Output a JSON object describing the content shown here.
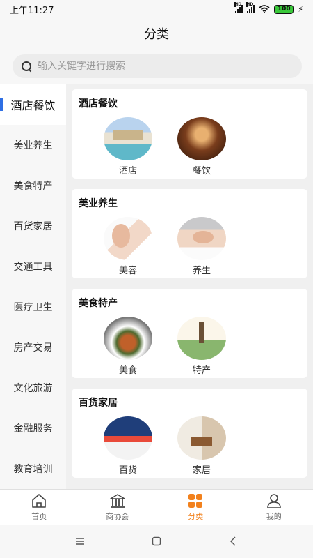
{
  "status": {
    "time": "上午11:27",
    "battery": "100",
    "hd1": "HD",
    "hd2": "HD"
  },
  "header": {
    "title": "分类"
  },
  "search": {
    "placeholder": "输入关键字进行搜索"
  },
  "sidebar": {
    "items": [
      {
        "label": "酒店餐饮",
        "active": true
      },
      {
        "label": "美业养生"
      },
      {
        "label": "美食特产"
      },
      {
        "label": "百货家居"
      },
      {
        "label": "交通工具"
      },
      {
        "label": "医疗卫生"
      },
      {
        "label": "房产交易"
      },
      {
        "label": "文化旅游"
      },
      {
        "label": "金融服务"
      },
      {
        "label": "教育培训"
      }
    ]
  },
  "sections": [
    {
      "title": "酒店餐饮",
      "items": [
        {
          "label": "酒店",
          "icon": "hotel-image"
        },
        {
          "label": "餐饮",
          "icon": "dining-image"
        }
      ]
    },
    {
      "title": "美业养生",
      "items": [
        {
          "label": "美容",
          "icon": "beauty-image"
        },
        {
          "label": "养生",
          "icon": "wellness-image"
        }
      ]
    },
    {
      "title": "美食特产",
      "items": [
        {
          "label": "美食",
          "icon": "food-image"
        },
        {
          "label": "特产",
          "icon": "specialty-image"
        }
      ]
    },
    {
      "title": "百货家居",
      "items": [
        {
          "label": "百货",
          "icon": "goods-image"
        },
        {
          "label": "家居",
          "icon": "home-image"
        }
      ]
    }
  ],
  "tabbar": {
    "tabs": [
      {
        "label": "首页",
        "icon": "home-icon"
      },
      {
        "label": "商协会",
        "icon": "institution-icon"
      },
      {
        "label": "分类",
        "icon": "category-grid-icon",
        "active": true
      },
      {
        "label": "我的",
        "icon": "user-icon"
      }
    ]
  },
  "colors": {
    "accent": "#f2811d",
    "active_indicator": "#2f6fe4"
  }
}
